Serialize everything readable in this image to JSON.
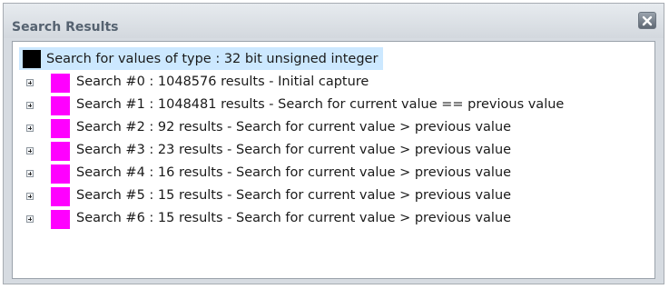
{
  "window": {
    "title": "Search Results",
    "close_icon": "close-x-icon"
  },
  "colors": {
    "root_swatch": "#000000",
    "search_swatch": "#ff00ff",
    "selection": "#cce8ff"
  },
  "tree": {
    "root_label": "Search for values of type : 32 bit unsigned integer",
    "items": [
      {
        "label": "Search #0 : 1048576 results - Initial capture",
        "expander_icon": "expand-plus-icon"
      },
      {
        "label": "Search #1 : 1048481 results - Search for current value == previous value",
        "expander_icon": "expand-plus-icon"
      },
      {
        "label": "Search #2 : 92 results - Search for current value > previous value",
        "expander_icon": "expand-plus-icon"
      },
      {
        "label": "Search #3 : 23 results - Search for current value > previous value",
        "expander_icon": "expand-plus-icon"
      },
      {
        "label": "Search #4 : 16 results - Search for current value > previous value",
        "expander_icon": "expand-plus-icon"
      },
      {
        "label": "Search #5 : 15 results - Search for current value > previous value",
        "expander_icon": "expand-plus-icon"
      },
      {
        "label": "Search #6 : 15 results - Search for current value > previous value",
        "expander_icon": "expand-plus-icon"
      }
    ]
  }
}
